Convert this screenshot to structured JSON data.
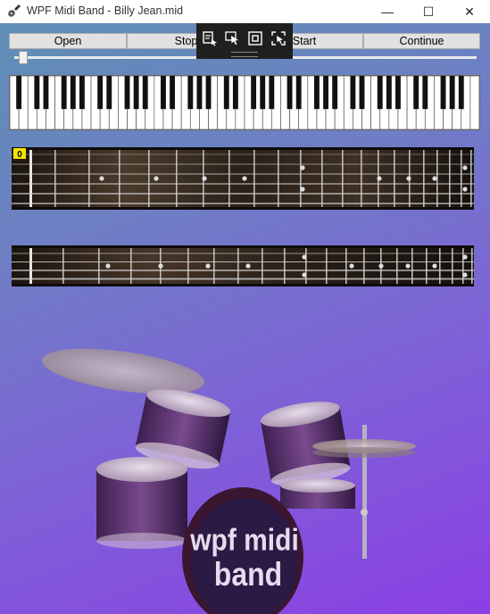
{
  "window": {
    "title": "WPF Midi Band - Billy Jean.mid",
    "minimize": "—",
    "maximize": "☐",
    "close": "✕"
  },
  "icons": {
    "app": "guitar-icon"
  },
  "controls": {
    "open": "Open",
    "stop": "Stop",
    "start": "Start",
    "continue": "Continue"
  },
  "position_slider": {
    "value": 0.01
  },
  "toolbar": {
    "items": [
      "select-element-icon",
      "pointer-icon",
      "frame-icon",
      "screenshot-icon"
    ]
  },
  "guitar": {
    "fret_badge": "0"
  },
  "drum_logo": {
    "line1": "wpf midi",
    "line2": "band"
  },
  "colors": {
    "accent_badge": "#f2e600",
    "background_top": "#5f8fb6",
    "background_bottom": "#8b3fe4"
  }
}
